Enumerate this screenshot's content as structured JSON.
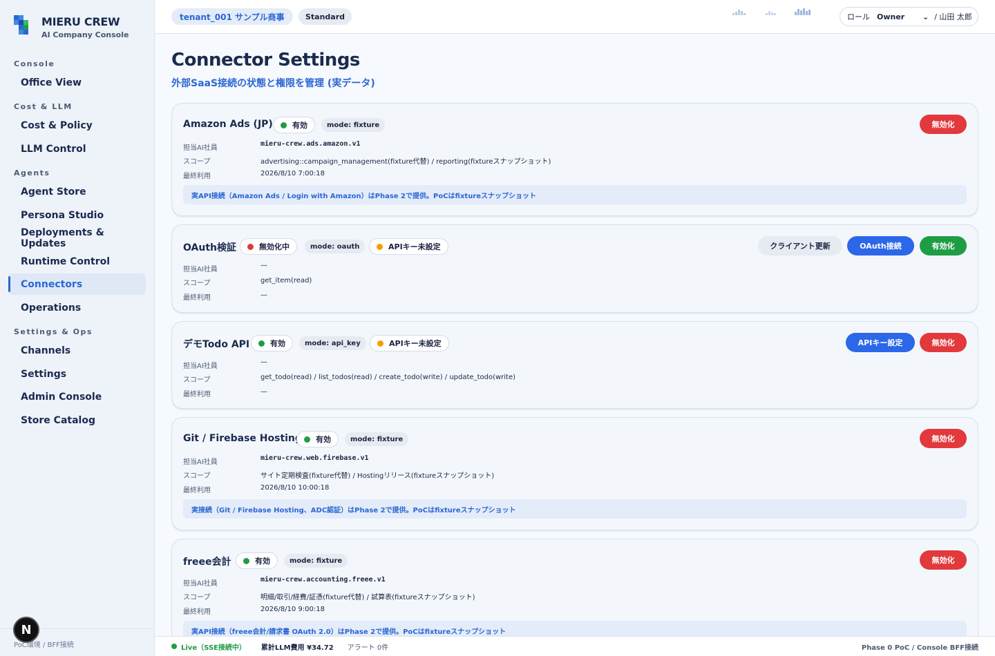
{
  "brand": {
    "name": "MIERU CREW",
    "subtitle": "AI Company Console"
  },
  "sidebar": {
    "sections": [
      {
        "label": "Console",
        "items": [
          {
            "label": "Office View"
          }
        ]
      },
      {
        "label": "Cost & LLM",
        "items": [
          {
            "label": "Cost & Policy"
          },
          {
            "label": "LLM Control"
          }
        ]
      },
      {
        "label": "Agents",
        "items": [
          {
            "label": "Agent Store"
          },
          {
            "label": "Persona Studio"
          },
          {
            "label": "Deployments & Updates"
          },
          {
            "label": "Runtime Control"
          },
          {
            "label": "Connectors",
            "active": true
          },
          {
            "label": "Operations"
          }
        ]
      },
      {
        "label": "Settings & Ops",
        "items": [
          {
            "label": "Channels"
          },
          {
            "label": "Settings"
          },
          {
            "label": "Admin Console"
          },
          {
            "label": "Store Catalog"
          }
        ]
      }
    ],
    "footer": "PoC環境 / BFF接続",
    "badge": "N"
  },
  "topbar": {
    "tenant": "tenant_001 サンプル商事",
    "plan": "Standard",
    "role_label": "ロール",
    "role_value": "Owner",
    "user": "/ 山田 太郎"
  },
  "page": {
    "title": "Connector Settings",
    "subtitle": "外部SaaS接続の状態と権限を管理 (実データ)"
  },
  "labels": {
    "agent": "担当AI社員",
    "scope": "スコープ",
    "last_used": "最終利用"
  },
  "colors": {
    "enabled_dot": "#1f9d45",
    "disabled_dot": "#e2393c",
    "warning_dot": "#f5a000",
    "accent": "#2b67d4"
  },
  "connectors": [
    {
      "name": "Amazon Ads (JP)",
      "status": "有効",
      "mode": "mode: fixture",
      "agent": "mieru-crew.ads.amazon.v1",
      "scope": "advertising::campaign_management(fixture代替) / reporting(fixtureスナップショット)",
      "last_used": "2026/8/10 7:00:18",
      "note": "実API接続（Amazon Ads / Login with Amazon）はPhase 2で提供。PoCはfixtureスナップショット",
      "buttons": [
        "無効化"
      ]
    },
    {
      "name": "OAuth検証",
      "status": "無効化中",
      "mode": "mode: oauth",
      "warning": "APIキー未設定",
      "agent": "—",
      "scope": "get_item(read)",
      "last_used": "—",
      "buttons": [
        "クライアント更新",
        "OAuth接続",
        "有効化"
      ]
    },
    {
      "name": "デモTodo API",
      "status": "有効",
      "mode": "mode: api_key",
      "warning": "APIキー未設定",
      "agent": "—",
      "scope": "get_todo(read) / list_todos(read) / create_todo(write) / update_todo(write)",
      "last_used": "—",
      "buttons": [
        "APIキー設定",
        "無効化"
      ]
    },
    {
      "name": "Git / Firebase Hosting",
      "status": "有効",
      "mode": "mode: fixture",
      "agent": "mieru-crew.web.firebase.v1",
      "scope": "サイト定期検査(fixture代替) / Hostingリリース(fixtureスナップショット)",
      "last_used": "2026/8/10 10:00:18",
      "note": "実接続（Git / Firebase Hosting、ADC認証）はPhase 2で提供。PoCはfixtureスナップショット",
      "buttons": [
        "無効化"
      ]
    },
    {
      "name": "freee会計",
      "status": "有効",
      "mode": "mode: fixture",
      "agent": "mieru-crew.accounting.freee.v1",
      "scope": "明細/取引/経費/証憑(fixture代替) / 試算表(fixtureスナップショット)",
      "last_used": "2026/8/10 9:00:18",
      "note": "実API接続（freee会計/請求書 OAuth 2.0）はPhase 2で提供。PoCはfixtureスナップショット",
      "buttons": [
        "無効化"
      ]
    }
  ],
  "statusbar": {
    "live": "Live（SSE接続中）",
    "cost": "累計LLM費用 ¥34.72",
    "alerts": "アラート 0件",
    "phase": "Phase 0 PoC / Console BFF接続"
  }
}
